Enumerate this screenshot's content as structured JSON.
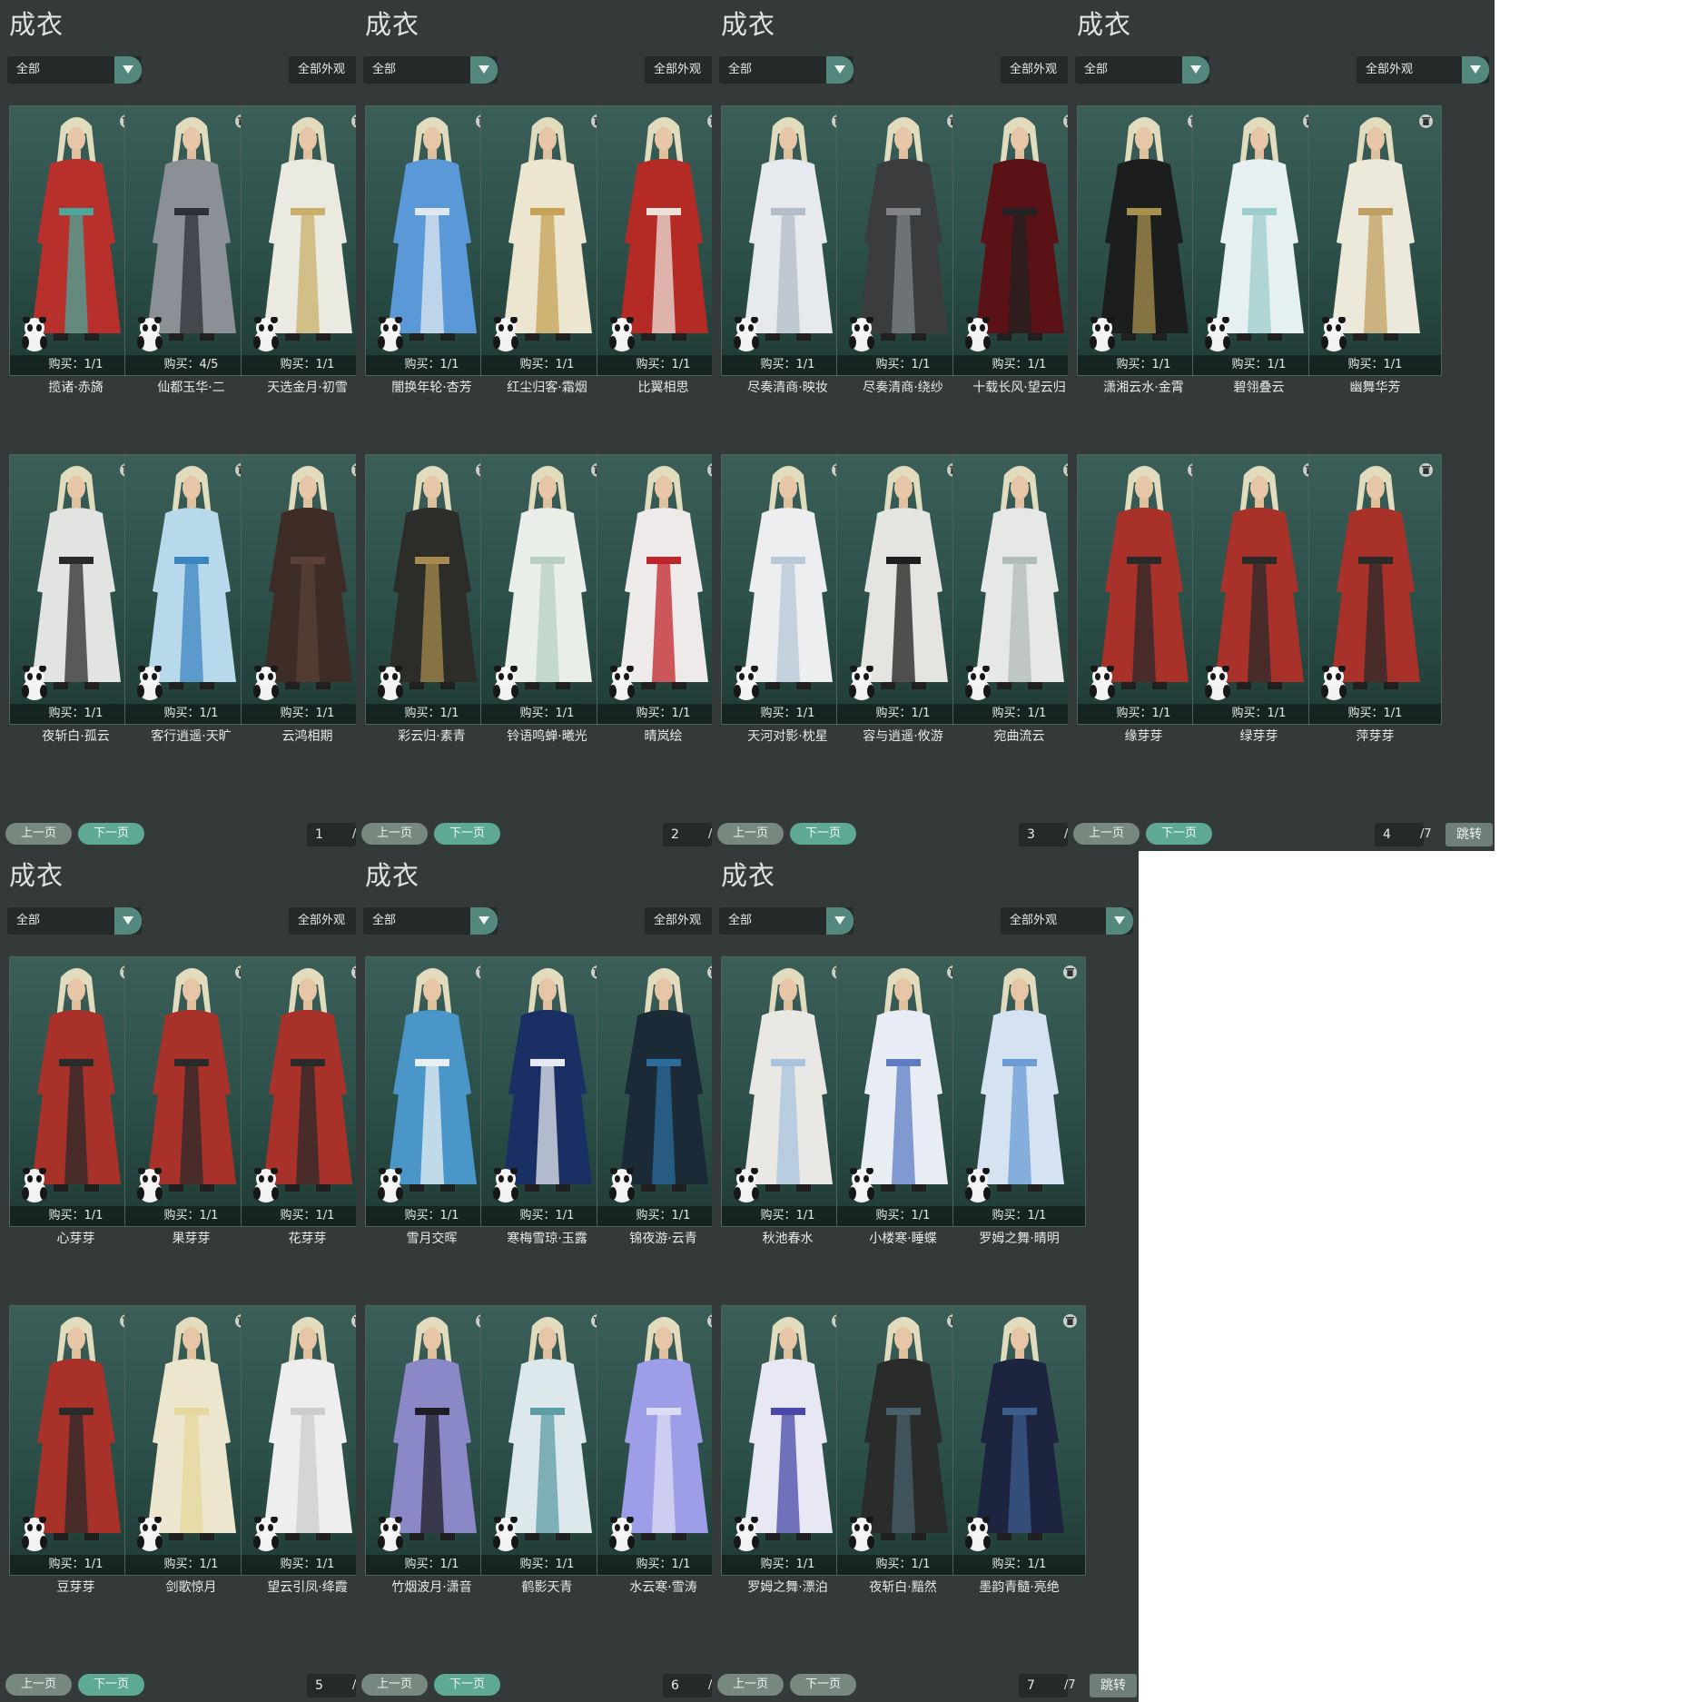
{
  "title": "成衣",
  "filter_left": "全部",
  "filter_right": "全部外观",
  "prev_label": "上一页",
  "next_label": "下一页",
  "jump_label": "跳转",
  "page_total": "/7",
  "colors": {
    "panel_bg": "#333a39",
    "card_bg": "#2c5049",
    "accent": "#5ea896"
  },
  "icons": {
    "dropdown": "chevron-down-icon",
    "delete": "trash-icon",
    "mascot": "panda-icon"
  },
  "panels": [
    {
      "page": "1",
      "cards": [
        {
          "name": "揽诸·赤旖",
          "purchase": "购买：1/1",
          "outfit": "#b8302c",
          "accent": "#4aa79a"
        },
        {
          "name": "仙都玉华·二",
          "purchase": "购买：4/5",
          "outfit": "#8a9096",
          "accent": "#2c3034"
        },
        {
          "name": "天选金月·初雪",
          "purchase": "购买：1/1",
          "outfit": "#ebeae0",
          "accent": "#c8b06a"
        },
        {
          "name": "夜斩白·孤云",
          "purchase": "购买：1/1",
          "outfit": "#e2e4e2",
          "accent": "#2a2c2c"
        },
        {
          "name": "客行逍遥·天旷",
          "purchase": "购买：1/1",
          "outfit": "#b8d8ec",
          "accent": "#3c86c0"
        },
        {
          "name": "云鸿相期",
          "purchase": "购买：1/1",
          "outfit": "#3e2c26",
          "accent": "#5a4036"
        }
      ]
    },
    {
      "page": "2",
      "cards": [
        {
          "name": "闇换年轮·杏芳",
          "purchase": "购买：1/1",
          "outfit": "#5a98d8",
          "accent": "#dfe8f0"
        },
        {
          "name": "红尘归客·霜烟",
          "purchase": "购买：1/1",
          "outfit": "#ece6d0",
          "accent": "#c6a256"
        },
        {
          "name": "比翼相思",
          "purchase": "购买：1/1",
          "outfit": "#b42a24",
          "accent": "#ece2d8"
        },
        {
          "name": "彩云归·素青",
          "purchase": "购买：1/1",
          "outfit": "#2c2c28",
          "accent": "#a68a4e"
        },
        {
          "name": "铃语鸣蝉·曦光",
          "purchase": "购买：1/1",
          "outfit": "#eaeee8",
          "accent": "#b8d0c4"
        },
        {
          "name": "晴岚绘",
          "purchase": "购买：1/1",
          "outfit": "#eeeaea",
          "accent": "#c0242a"
        }
      ]
    },
    {
      "page": "3",
      "cards": [
        {
          "name": "尽奏清商·映妆",
          "purchase": "购买：1/1",
          "outfit": "#e6eaee",
          "accent": "#b2bcc6"
        },
        {
          "name": "尽奏清商·绕纱",
          "purchase": "购买：1/1",
          "outfit": "#3a3c3e",
          "accent": "#7e8488"
        },
        {
          "name": "十载长风·望云归",
          "purchase": "购买：1/1",
          "outfit": "#5a1216",
          "accent": "#222222"
        },
        {
          "name": "天河对影·枕星",
          "purchase": "购买：1/1",
          "outfit": "#eceef0",
          "accent": "#b8c8d8"
        },
        {
          "name": "容与逍遥·攸游",
          "purchase": "购买：1/1",
          "outfit": "#e4e4e0",
          "accent": "#1e1e1e"
        },
        {
          "name": "宛曲流云",
          "purchase": "购买：1/1",
          "outfit": "#e6e8e6",
          "accent": "#b0bcb8"
        }
      ]
    },
    {
      "page": "4",
      "cards": [
        {
          "name": "潇湘云水·金霄",
          "purchase": "购买：1/1",
          "outfit": "#1c1e1e",
          "accent": "#a8904e"
        },
        {
          "name": "碧翎叠云",
          "purchase": "购买：1/1",
          "outfit": "#e6f0f0",
          "accent": "#9ccccc"
        },
        {
          "name": "幽舞华芳",
          "purchase": "购买：1/1",
          "outfit": "#ece8da",
          "accent": "#c0a060"
        },
        {
          "name": "缘芽芽",
          "purchase": "购买：1/1",
          "outfit": "#a8322a",
          "accent": "#2a2a2a"
        },
        {
          "name": "绿芽芽",
          "purchase": "购买：1/1",
          "outfit": "#a8322a",
          "accent": "#2a2a2a"
        },
        {
          "name": "萍芽芽",
          "purchase": "购买：1/1",
          "outfit": "#a8322a",
          "accent": "#2a2a2a"
        }
      ]
    },
    {
      "page": "5",
      "cards": [
        {
          "name": "心芽芽",
          "purchase": "购买：1/1",
          "outfit": "#a8322a",
          "accent": "#2a2a2a"
        },
        {
          "name": "果芽芽",
          "purchase": "购买：1/1",
          "outfit": "#a8322a",
          "accent": "#2a2a2a"
        },
        {
          "name": "花芽芽",
          "purchase": "购买：1/1",
          "outfit": "#a8322a",
          "accent": "#2a2a2a"
        },
        {
          "name": "豆芽芽",
          "purchase": "购买：1/1",
          "outfit": "#a8322a",
          "accent": "#2a2a2a"
        },
        {
          "name": "剑歌惊月",
          "purchase": "购买：1/1",
          "outfit": "#ece6ce",
          "accent": "#e6d89a"
        },
        {
          "name": "望云引凤·绛霞",
          "purchase": "购买：1/1",
          "outfit": "#eeeeee",
          "accent": "#cccccc"
        }
      ]
    },
    {
      "page": "6",
      "cards": [
        {
          "name": "雪月交晖",
          "purchase": "购买：1/1",
          "outfit": "#4a96c8",
          "accent": "#e8f0f4"
        },
        {
          "name": "寒梅雪琼·玉露",
          "purchase": "购买：1/1",
          "outfit": "#1a3064",
          "accent": "#e6eaf0"
        },
        {
          "name": "锦夜游·云青",
          "purchase": "购买：1/1",
          "outfit": "#1a2a36",
          "accent": "#2c6c9c"
        },
        {
          "name": "竹烟波月·潇音",
          "purchase": "购买：1/1",
          "outfit": "#8a88c6",
          "accent": "#1e1e24"
        },
        {
          "name": "鹤影天青",
          "purchase": "购买：1/1",
          "outfit": "#dce8ec",
          "accent": "#5c9ea4"
        },
        {
          "name": "水云寒·雪涛",
          "purchase": "购买：1/1",
          "outfit": "#9e9ee8",
          "accent": "#dcdcf4"
        }
      ]
    },
    {
      "page": "7",
      "cards": [
        {
          "name": "秋池春水",
          "purchase": "购买：1/1",
          "outfit": "#eae8e4",
          "accent": "#a8c4e0"
        },
        {
          "name": "小楼寒·睡蝶",
          "purchase": "购买：1/1",
          "outfit": "#e8ecf4",
          "accent": "#5e7ec4"
        },
        {
          "name": "罗姆之舞·晴明",
          "purchase": "购买：1/1",
          "outfit": "#d4e2f2",
          "accent": "#6c9cd4"
        },
        {
          "name": "罗姆之舞·漂泊",
          "purchase": "购买：1/1",
          "outfit": "#e8e8f4",
          "accent": "#4a48a8"
        },
        {
          "name": "夜斩白·黯然",
          "purchase": "购买：1/1",
          "outfit": "#2a2c2c",
          "accent": "#48606a"
        },
        {
          "name": "墨韵青髓·亮绝",
          "purchase": "购买：1/1",
          "outfit": "#1c2440",
          "accent": "#3c5c8c"
        }
      ]
    }
  ]
}
